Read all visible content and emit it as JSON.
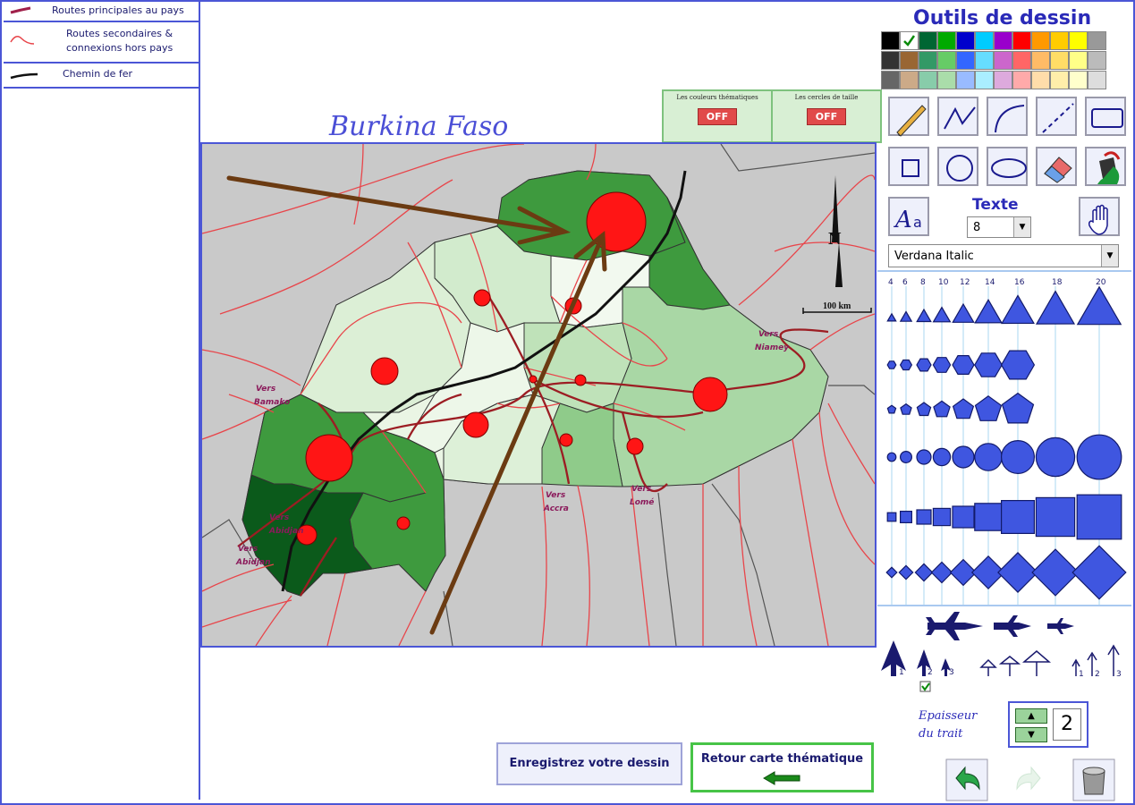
{
  "legend": {
    "items": [
      {
        "label_lines": [
          "Routes principales au pays"
        ],
        "color": "#a0204a"
      },
      {
        "label_lines": [
          "Routes secondaires &",
          "connexions hors pays"
        ],
        "color": "#e8454a"
      },
      {
        "label_lines": [
          "Chemin de fer"
        ],
        "color": "#111111"
      }
    ]
  },
  "map": {
    "title": "Burkina Faso",
    "north_label": "N",
    "scale_label": "100 km",
    "place_labels": [
      {
        "lines": [
          "Vers",
          "Niamey"
        ]
      },
      {
        "lines": [
          "Vers",
          "Bamako"
        ]
      },
      {
        "lines": [
          "Vers",
          "Abidjan"
        ]
      },
      {
        "lines": [
          "Vers",
          "Abidjan"
        ]
      },
      {
        "lines": [
          "Vers",
          "Accra"
        ]
      },
      {
        "lines": [
          "Vers",
          "Lomé"
        ]
      }
    ]
  },
  "toggles": [
    {
      "label": "Les couleurs thématiques",
      "state": "OFF"
    },
    {
      "label": "Les cercles de taille",
      "state": "OFF"
    }
  ],
  "tools": {
    "title": "Outils de dessin",
    "palette": [
      [
        "#000000",
        "#ffffff",
        "#006633",
        "#00aa00",
        "#0000cc",
        "#00ccff",
        "#9900cc",
        "#ff0000",
        "#ff9900",
        "#ffcc00",
        "#ffff00",
        "#999999"
      ],
      [
        "#333333",
        "#996633",
        "#339966",
        "#66cc66",
        "#3366ff",
        "#66ddff",
        "#cc66cc",
        "#ff6666",
        "#ffbb66",
        "#ffdd66",
        "#ffff88",
        "#bbbbbb"
      ],
      [
        "#666666",
        "#ccaa88",
        "#88ccaa",
        "#aaddaa",
        "#99bbff",
        "#aaeeff",
        "#ddaadd",
        "#ffaaaa",
        "#ffddaa",
        "#ffeeaa",
        "#ffffcc",
        "#dddddd"
      ]
    ],
    "text_label": "Texte",
    "font_size": "8",
    "font_name": "Verdana Italic",
    "symbol_sizes": [
      "4",
      "6",
      "8",
      "10",
      "12",
      "14",
      "16",
      "18",
      "20"
    ],
    "arrow_sizes": [
      "1",
      "2",
      "3"
    ],
    "thickness_label_lines": [
      "Epaisseur",
      "du trait"
    ],
    "thickness_value": "2"
  },
  "buttons": {
    "save": "Enregistrez votre dessin",
    "back": "Retour carte thématique"
  }
}
